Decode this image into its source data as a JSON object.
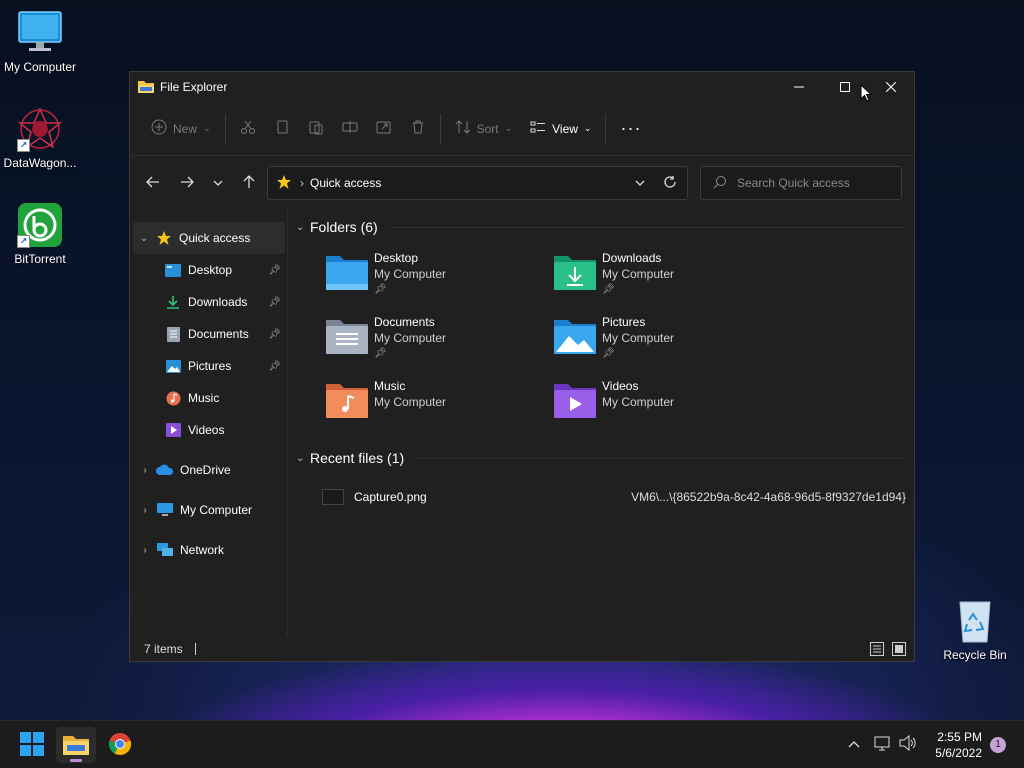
{
  "desktop": {
    "icons": [
      {
        "label": "My Computer"
      },
      {
        "label": "DataWagon..."
      },
      {
        "label": "BitTorrent"
      },
      {
        "label": "Recycle Bin"
      }
    ]
  },
  "window": {
    "title": "File Explorer",
    "toolbar": {
      "new_label": "New",
      "sort_label": "Sort",
      "view_label": "View"
    },
    "address": {
      "crumb": "Quick access"
    },
    "search": {
      "placeholder": "Search Quick access"
    }
  },
  "nav": {
    "quick_access": "Quick access",
    "items": [
      {
        "label": "Desktop",
        "pinned": true
      },
      {
        "label": "Downloads",
        "pinned": true
      },
      {
        "label": "Documents",
        "pinned": true
      },
      {
        "label": "Pictures",
        "pinned": true
      },
      {
        "label": "Music",
        "pinned": false
      },
      {
        "label": "Videos",
        "pinned": false
      }
    ],
    "onedrive": "OneDrive",
    "my_computer": "My Computer",
    "network": "Network"
  },
  "main": {
    "folders_header": "Folders (6)",
    "folders": [
      {
        "name": "Desktop",
        "location": "My Computer"
      },
      {
        "name": "Downloads",
        "location": "My Computer"
      },
      {
        "name": "Documents",
        "location": "My Computer"
      },
      {
        "name": "Pictures",
        "location": "My Computer"
      },
      {
        "name": "Music",
        "location": "My Computer"
      },
      {
        "name": "Videos",
        "location": "My Computer"
      }
    ],
    "recent_header": "Recent files (1)",
    "recent": [
      {
        "name": "Capture0.png",
        "path": "VM6\\...\\{86522b9a-8c42-4a68-96d5-8f9327de1d94}"
      }
    ]
  },
  "status": {
    "items": "7 items"
  },
  "taskbar": {
    "time": "2:55 PM",
    "date": "5/6/2022",
    "notification_count": "1"
  }
}
